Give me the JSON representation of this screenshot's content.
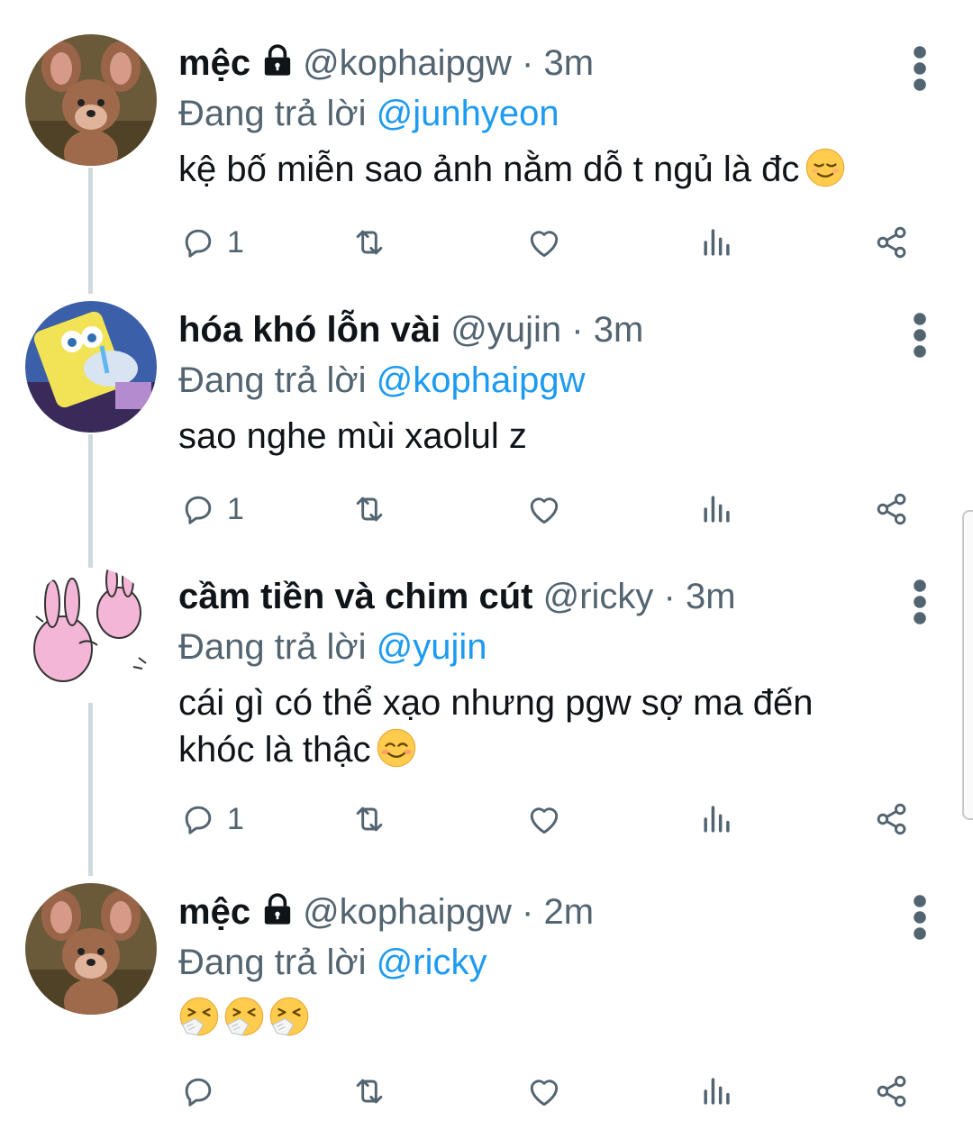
{
  "tweets": [
    {
      "name": "mệc",
      "locked": true,
      "handle": "@kophaipgw",
      "dot": "·",
      "time": "3m",
      "reply_prefix": "Đang trả lời",
      "reply_to": "@junhyeon",
      "text": "kệ bố miễn sao ảnh nằm dỗ t ngủ là đc",
      "emoji": "relieved-face",
      "reply_count": "1"
    },
    {
      "name": "hóa khó lỗn vài",
      "locked": false,
      "handle": "@yujin",
      "dot": "·",
      "time": "3m",
      "reply_prefix": "Đang trả lời",
      "reply_to": "@kophaipgw",
      "text": "sao nghe mùi xaolul z",
      "reply_count": "1"
    },
    {
      "name": "cầm tiền và chim cút",
      "locked": false,
      "handle": "@ricky",
      "dot": "·",
      "time": "3m",
      "reply_prefix": "Đang trả lời",
      "reply_to": "@yujin",
      "text_line1": "cái gì có thể xạo nhưng pgw sợ ma đến",
      "text_line2": "khóc là thậc",
      "emoji": "smiling-face",
      "reply_count": "1"
    },
    {
      "name": "mệc",
      "locked": true,
      "handle": "@kophaipgw",
      "dot": "·",
      "time": "2m",
      "reply_prefix": "Đang trả lời",
      "reply_to": "@ricky",
      "emoji": "sneezing-face x3",
      "reply_count": ""
    }
  ],
  "icons": [
    "reply-icon",
    "retweet-icon",
    "like-icon",
    "analytics-icon",
    "share-icon",
    "more-icon",
    "lock-icon"
  ],
  "colors": {
    "link": "#1d9bf0",
    "muted": "#536471",
    "text": "#0f1419",
    "thread": "#cfd9de"
  }
}
